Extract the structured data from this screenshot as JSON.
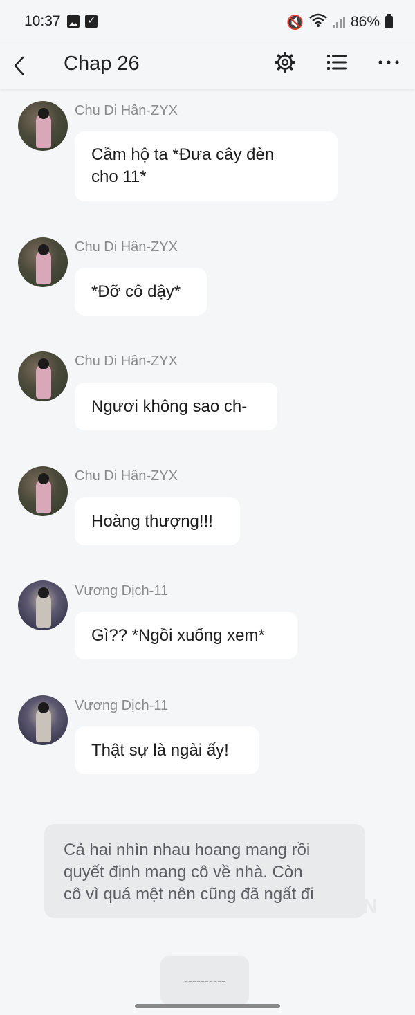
{
  "status_bar": {
    "time": "10:37",
    "battery": "86%"
  },
  "app_bar": {
    "title": "Chap 26"
  },
  "messages": [
    {
      "sender": "Chu Di Hân-ZYX",
      "text_lines": [
        "Cầm hộ ta *Đưa cây đèn",
        "cho 11*"
      ],
      "avatar": "chu"
    },
    {
      "sender": "Chu Di Hân-ZYX",
      "text_lines": [
        "*Đỡ cô dậy*"
      ],
      "avatar": "chu"
    },
    {
      "sender": "Chu Di Hân-ZYX",
      "text_lines": [
        "Ngươi không sao ch-"
      ],
      "avatar": "chu"
    },
    {
      "sender": "Chu Di Hân-ZYX",
      "text_lines": [
        "Hoàng thượng!!!"
      ],
      "avatar": "chu"
    },
    {
      "sender": "Vương Dịch-11",
      "text_lines": [
        "Gì?? *Ngồi xuống xem*"
      ],
      "avatar": "vuong"
    },
    {
      "sender": "Vương Dịch-11",
      "text_lines": [
        "Thật sự là ngài ấy!"
      ],
      "avatar": "vuong"
    }
  ],
  "narration": {
    "lines": [
      "Cả hai nhìn nhau hoang mang rồi",
      "quyết định mang cô về nhà. Còn",
      "cô vì quá mệt nên cũng đã ngất đi"
    ]
  },
  "watermark": "ON",
  "divider": "----------",
  "icons": {
    "back": "back-arrow-icon",
    "settings": "gear-icon",
    "list": "list-icon",
    "more": "more-dots-icon"
  }
}
